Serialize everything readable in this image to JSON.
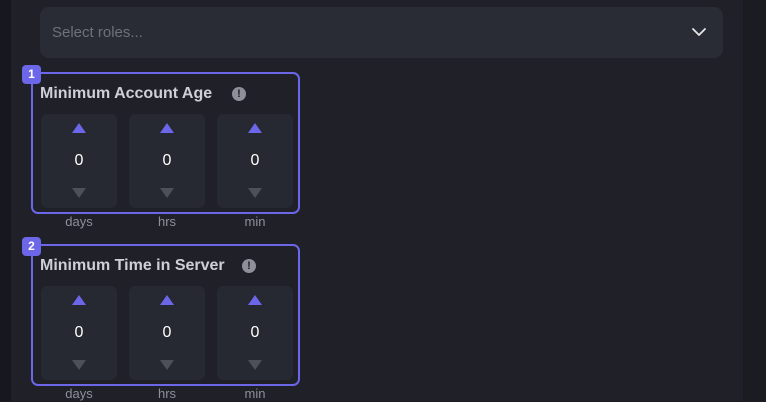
{
  "roles_select": {
    "placeholder": "Select roles..."
  },
  "groups": [
    {
      "badge": "1",
      "title": "Minimum Account Age",
      "info_glyph": "!",
      "steppers": [
        {
          "value": "0",
          "unit": "days"
        },
        {
          "value": "0",
          "unit": "hrs"
        },
        {
          "value": "0",
          "unit": "min"
        }
      ]
    },
    {
      "badge": "2",
      "title": "Minimum Time in Server",
      "info_glyph": "!",
      "steppers": [
        {
          "value": "0",
          "unit": "days"
        },
        {
          "value": "0",
          "unit": "hrs"
        },
        {
          "value": "0",
          "unit": "min"
        }
      ]
    }
  ],
  "icons": {
    "dropdown": "chevron-down-icon",
    "increment": "triangle-up-icon",
    "decrement": "triangle-down-icon",
    "info": "info-circle-icon"
  },
  "colors": {
    "accent": "#6c66e8",
    "background": "#1f2028",
    "field": "#2a2c35",
    "stepper": "#272932"
  }
}
